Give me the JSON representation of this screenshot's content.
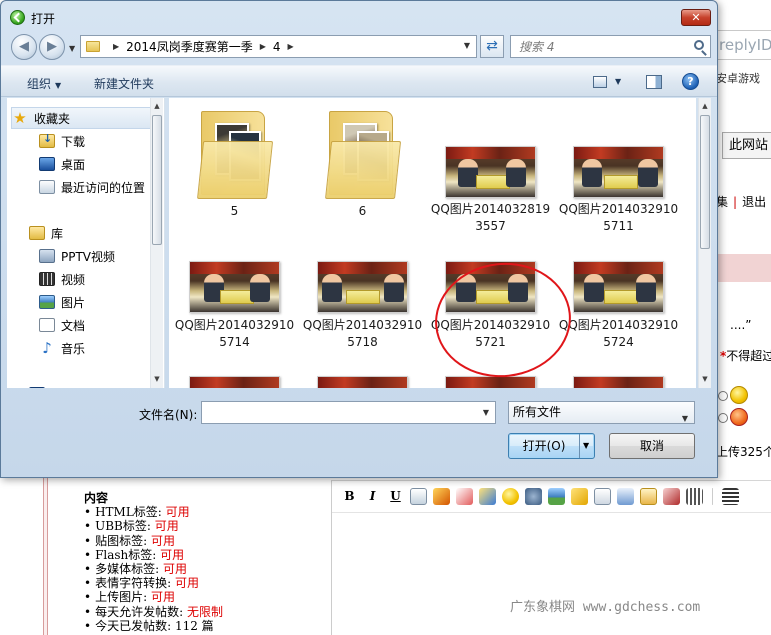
{
  "background": {
    "top_input_text": "replyID",
    "android_games": "安卓游戏",
    "site_button": "此网站",
    "links": [
      "集",
      "退出"
    ],
    "quote_dots": "....”",
    "limit_text": "不得超过",
    "upload_text": "上传325个",
    "content_title": "内容",
    "features": [
      {
        "label": "HTML标签: ",
        "value": "可用"
      },
      {
        "label": "UBB标签: ",
        "value": "可用"
      },
      {
        "label": "贴图标签: ",
        "value": "可用"
      },
      {
        "label": "Flash标签: ",
        "value": "可用"
      },
      {
        "label": "多媒体标签: ",
        "value": "可用"
      },
      {
        "label": "表情字符转换: ",
        "value": "可用"
      },
      {
        "label": "上传图片: ",
        "value": "可用"
      },
      {
        "label": "每天允许发帖数: ",
        "value": "无限制"
      },
      {
        "label": "今天已发帖数: ",
        "value": "112 篇"
      }
    ],
    "editor_buttons": [
      "B",
      "I",
      "U"
    ],
    "watermark": "广东象棋网 www.gdchess.com"
  },
  "dialog": {
    "title": "打开",
    "close_label": "✕",
    "address": {
      "crumbs": [
        "2014凤岗季度赛第一季",
        "4"
      ]
    },
    "search_placeholder": "搜索 4",
    "toolbar": {
      "organize": "组织",
      "new_folder": "新建文件夹",
      "help": "?"
    },
    "nav": {
      "favorites": "收藏夹",
      "downloads": "下载",
      "desktop": "桌面",
      "recent": "最近访问的位置",
      "libraries": "库",
      "pptv": "PPTV视频",
      "videos": "视频",
      "pictures": "图片",
      "documents": "文档",
      "music": "音乐"
    },
    "files": [
      {
        "name": "5",
        "type": "folder"
      },
      {
        "name": "6",
        "type": "folder"
      },
      {
        "name": "QQ图片20140328193557",
        "type": "image"
      },
      {
        "name": "QQ图片20140329105711",
        "type": "image"
      },
      {
        "name": "QQ图片20140329105714",
        "type": "image"
      },
      {
        "name": "QQ图片20140329105718",
        "type": "image"
      },
      {
        "name": "QQ图片20140329105721",
        "type": "image"
      },
      {
        "name": "QQ图片20140329105724",
        "type": "image"
      }
    ],
    "filename_label": "文件名(N):",
    "filename_value": "",
    "file_type": "所有文件",
    "open_button": "打开(O)",
    "cancel_button": "取消"
  },
  "colors": {
    "highlight_circle": "#e0161a",
    "value_red": "#dd0000",
    "dialog_frame": "#c5d7ea"
  }
}
